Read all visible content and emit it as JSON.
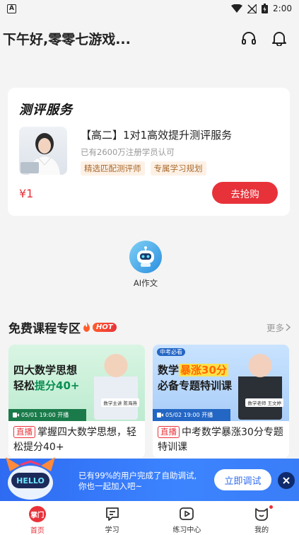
{
  "status_bar": {
    "time": "2:00",
    "left_icon": "A"
  },
  "header": {
    "greeting": "下午好,零零七游戏..."
  },
  "eval_card": {
    "title": "测评服务",
    "name": "【高二】1对1高效提升测评服务",
    "subtitle": "已有2600万注册学员认可",
    "tags": [
      "精选匹配测评师",
      "专属学习规划"
    ],
    "price": "¥1",
    "button": "去抢购"
  },
  "ai_entry": {
    "label": "AI作文"
  },
  "free_courses": {
    "title": "免费课程专区",
    "hot_badge": "HOT",
    "more": "更多",
    "items": [
      {
        "banner_line1": "四大数学思想",
        "banner_line2_prefix": "轻松",
        "banner_line2_highlight": "提分40+",
        "date": "05/01 19:00 开播",
        "teacher": "数学主讲 陈海燕",
        "live_tag": "直播",
        "title": "掌握四大数学思想，轻松提分40+"
      },
      {
        "badge": "中考必看",
        "banner_line1_prefix": "数学",
        "banner_line1_highlight": "暴涨30分",
        "banner_line2": "必备专题特训课",
        "date": "05/02 19:00 开播",
        "teacher": "数学老师 王文婷",
        "live_tag": "直播",
        "title": "中考数学暴涨30分专题特训课"
      }
    ]
  },
  "promo": {
    "text_line1": "已有99%的用户完成了自助调试,",
    "text_line2": "你也一起加入吧~",
    "button": "立即调试",
    "mascot_text": "HELLO"
  },
  "tabbar": {
    "items": [
      {
        "label": "首页",
        "icon_text": "掌门"
      },
      {
        "label": "学习"
      },
      {
        "label": "练习中心"
      },
      {
        "label": "我的"
      }
    ]
  }
}
